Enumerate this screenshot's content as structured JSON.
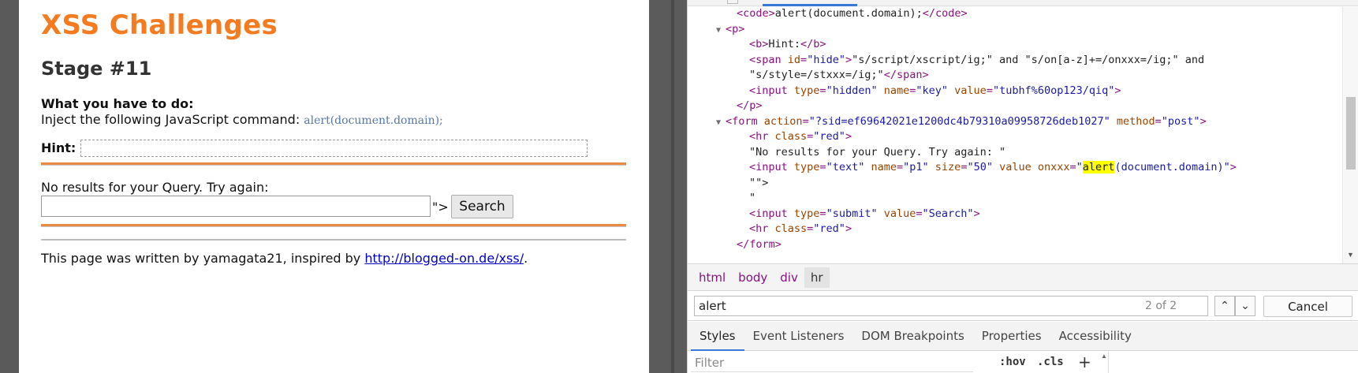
{
  "page": {
    "title": "XSS Challenges",
    "stage": "Stage #11",
    "todo_label": "What you have to do:",
    "inject_text": "Inject the following JavaScript command: ",
    "inject_code": "alert(document.domain);",
    "hint_label": "Hint:",
    "no_results": "No results for your Query. Try again:",
    "query_value": "",
    "after_input": "\">",
    "search_button": "Search",
    "footer_text": "This page was written by yamagata21, inspired by ",
    "footer_link": "http://blogged-on.de/xss/",
    "footer_end": ".",
    "accent_color": "#f47b20"
  },
  "devtools": {
    "dom": [
      {
        "indent": 4,
        "arrow": "",
        "parts": [
          [
            "tag",
            "<code>"
          ],
          [
            "txt",
            "alert(document.domain);"
          ],
          [
            "tag",
            "</code>"
          ]
        ]
      },
      {
        "indent": 3,
        "arrow": "▼",
        "parts": [
          [
            "tag",
            "<p>"
          ]
        ]
      },
      {
        "indent": 5,
        "arrow": "",
        "parts": [
          [
            "tag",
            "<b>"
          ],
          [
            "txt",
            "Hint:"
          ],
          [
            "tag",
            "</b>"
          ]
        ]
      },
      {
        "indent": 5,
        "arrow": "",
        "parts": [
          [
            "tag",
            "<span "
          ],
          [
            "attr",
            "id"
          ],
          [
            "tag",
            "="
          ],
          [
            "val",
            "\"hide\""
          ],
          [
            "tag",
            ">"
          ],
          [
            "txt",
            "\"s/script/xscript/ig;\" and \"s/on[a-z]+=/onxxx=/ig;\" and"
          ]
        ]
      },
      {
        "indent": 5,
        "arrow": "",
        "parts": [
          [
            "txt",
            "\"s/style=/stxxx=/ig;\""
          ],
          [
            "tag",
            "</span>"
          ]
        ]
      },
      {
        "indent": 5,
        "arrow": "",
        "parts": [
          [
            "tag",
            "<input "
          ],
          [
            "attr",
            "type"
          ],
          [
            "tag",
            "="
          ],
          [
            "val",
            "\"hidden\""
          ],
          [
            "tag",
            " "
          ],
          [
            "attr",
            "name"
          ],
          [
            "tag",
            "="
          ],
          [
            "val",
            "\"key\""
          ],
          [
            "tag",
            " "
          ],
          [
            "attr",
            "value"
          ],
          [
            "tag",
            "="
          ],
          [
            "val",
            "\"tubhf%60op123/qiq\""
          ],
          [
            "tag",
            ">"
          ]
        ]
      },
      {
        "indent": 4,
        "arrow": "",
        "parts": [
          [
            "tag",
            "</p>"
          ]
        ]
      },
      {
        "indent": 3,
        "arrow": "▼",
        "parts": [
          [
            "tag",
            "<form "
          ],
          [
            "attr",
            "action"
          ],
          [
            "tag",
            "="
          ],
          [
            "val",
            "\"?sid=ef69642021e1200dc4b79310a09958726deb1027\""
          ],
          [
            "tag",
            " "
          ],
          [
            "attr",
            "method"
          ],
          [
            "tag",
            "="
          ],
          [
            "val",
            "\"post\""
          ],
          [
            "tag",
            ">"
          ]
        ]
      },
      {
        "indent": 5,
        "arrow": "",
        "parts": [
          [
            "tag",
            "<hr "
          ],
          [
            "attr",
            "class"
          ],
          [
            "tag",
            "="
          ],
          [
            "val",
            "\"red\""
          ],
          [
            "tag",
            ">"
          ]
        ]
      },
      {
        "indent": 5,
        "arrow": "",
        "parts": [
          [
            "txt",
            "\"No results for your Query. Try again: \""
          ]
        ]
      },
      {
        "indent": 5,
        "arrow": "",
        "parts": [
          [
            "tag",
            "<input "
          ],
          [
            "attr",
            "type"
          ],
          [
            "tag",
            "="
          ],
          [
            "val",
            "\"text\""
          ],
          [
            "tag",
            " "
          ],
          [
            "attr",
            "name"
          ],
          [
            "tag",
            "="
          ],
          [
            "val",
            "\"p1\""
          ],
          [
            "tag",
            " "
          ],
          [
            "attr",
            "size"
          ],
          [
            "tag",
            "="
          ],
          [
            "val",
            "\"50\""
          ],
          [
            "tag",
            " "
          ],
          [
            "attr",
            "value onxxx"
          ],
          [
            "tag",
            "="
          ],
          [
            "val",
            "\""
          ],
          [
            "hl",
            "alert"
          ],
          [
            "val",
            "(document.domain)\""
          ],
          [
            "tag",
            ">"
          ]
        ]
      },
      {
        "indent": 5,
        "arrow": "",
        "parts": [
          [
            "txt",
            "\"\">"
          ]
        ]
      },
      {
        "indent": 5,
        "arrow": "",
        "parts": [
          [
            "txt",
            "\""
          ]
        ]
      },
      {
        "indent": 5,
        "arrow": "",
        "parts": [
          [
            "tag",
            "<input "
          ],
          [
            "attr",
            "type"
          ],
          [
            "tag",
            "="
          ],
          [
            "val",
            "\"submit\""
          ],
          [
            "tag",
            " "
          ],
          [
            "attr",
            "value"
          ],
          [
            "tag",
            "="
          ],
          [
            "val",
            "\"Search\""
          ],
          [
            "tag",
            ">"
          ]
        ]
      },
      {
        "indent": 5,
        "arrow": "",
        "parts": [
          [
            "tag",
            "<hr "
          ],
          [
            "attr",
            "class"
          ],
          [
            "tag",
            "="
          ],
          [
            "val",
            "\"red\""
          ],
          [
            "tag",
            ">"
          ]
        ]
      },
      {
        "indent": 4,
        "arrow": "",
        "parts": [
          [
            "tag",
            "</form>"
          ]
        ]
      }
    ],
    "breadcrumbs": [
      "html",
      "body",
      "div",
      "hr"
    ],
    "find": {
      "query": "alert",
      "count": "2 of 2",
      "up": "⌃",
      "down": "⌄",
      "cancel": "Cancel"
    },
    "tabs": [
      "Styles",
      "Event Listeners",
      "DOM Breakpoints",
      "Properties",
      "Accessibility"
    ],
    "filter": {
      "placeholder": "Filter",
      "hov": ":hov",
      "cls": ".cls",
      "plus": "+"
    }
  }
}
